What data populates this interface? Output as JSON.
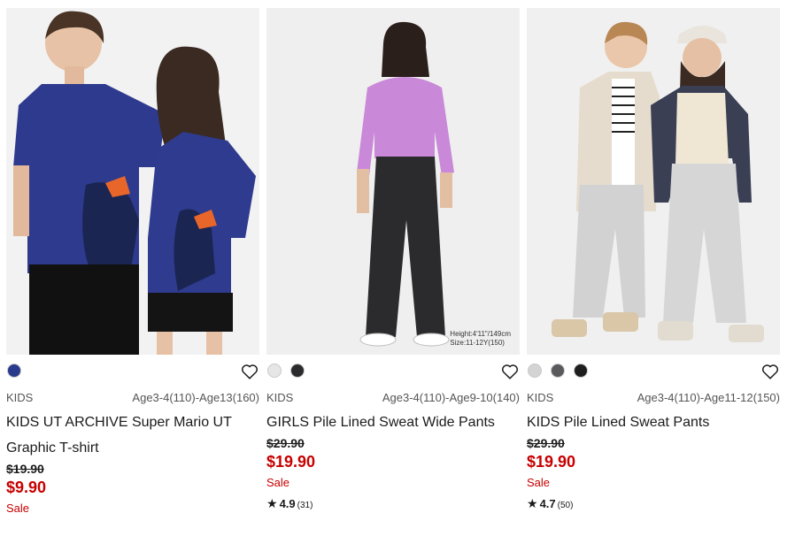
{
  "products": [
    {
      "category": "KIDS",
      "sizes": "Age3-4(110)-Age13(160)",
      "name": "KIDS UT ARCHIVE Super Mario UT Graphic T-shirt",
      "price_original": "$19.90",
      "price_sale": "$9.90",
      "sale_label": "Sale",
      "colors": [
        "#2a3a8c"
      ],
      "favorite_icon": "heart-outline-icon"
    },
    {
      "category": "KIDS",
      "sizes": "Age3-4(110)-Age9-10(140)",
      "name": "GIRLS Pile Lined Sweat Wide Pants",
      "price_original": "$29.90",
      "price_sale": "$19.90",
      "sale_label": "Sale",
      "rating": "4.9",
      "review_count": "(31)",
      "photo_caption_line1": "Height:4'11\"/149cm",
      "photo_caption_line2": "Size:11-12Y(150)",
      "colors": [
        "#e6e6e6",
        "#2b2b2e"
      ],
      "favorite_icon": "heart-outline-icon"
    },
    {
      "category": "KIDS",
      "sizes": "Age3-4(110)-Age11-12(150)",
      "name": "KIDS Pile Lined Sweat Pants",
      "price_original": "$29.90",
      "price_sale": "$19.90",
      "sale_label": "Sale",
      "rating": "4.7",
      "review_count": "(50)",
      "colors": [
        "#d4d4d4",
        "#5a5a5e",
        "#1e1e1e"
      ],
      "favorite_icon": "heart-outline-icon"
    }
  ],
  "rating_star_icon": "star-icon"
}
